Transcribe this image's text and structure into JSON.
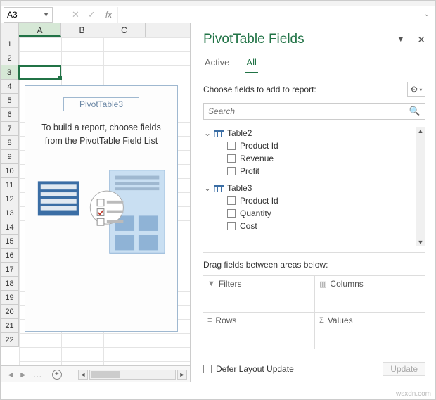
{
  "namebox": {
    "value": "A3"
  },
  "formula_bar": {
    "cancel": "✕",
    "accept": "✓",
    "fx": "fx"
  },
  "grid": {
    "columns": [
      "A",
      "B",
      "C"
    ],
    "active_col": "A",
    "rows": [
      "1",
      "2",
      "3",
      "4",
      "5",
      "6",
      "7",
      "8",
      "9",
      "10",
      "11",
      "12",
      "13",
      "14",
      "15",
      "16",
      "17",
      "18",
      "19",
      "20",
      "21",
      "22"
    ],
    "active_row": "3"
  },
  "pivot_placeholder": {
    "name": "PivotTable3",
    "hint": "To build a report, choose fields from the PivotTable Field List"
  },
  "task_pane": {
    "title": "PivotTable Fields",
    "tabs": {
      "active": "Active",
      "all": "All"
    },
    "choose_label": "Choose fields to add to report:",
    "search_placeholder": "Search",
    "tables": [
      {
        "name": "Table2",
        "fields": [
          "Product Id",
          "Revenue",
          "Profit"
        ]
      },
      {
        "name": "Table3",
        "fields": [
          "Product Id",
          "Quantity",
          "Cost"
        ]
      }
    ],
    "drag_label": "Drag fields between areas below:",
    "areas": {
      "filters": "Filters",
      "columns": "Columns",
      "rows": "Rows",
      "values": "Values"
    },
    "defer_label": "Defer Layout Update",
    "update_label": "Update"
  },
  "watermark": "wsxdn.com"
}
